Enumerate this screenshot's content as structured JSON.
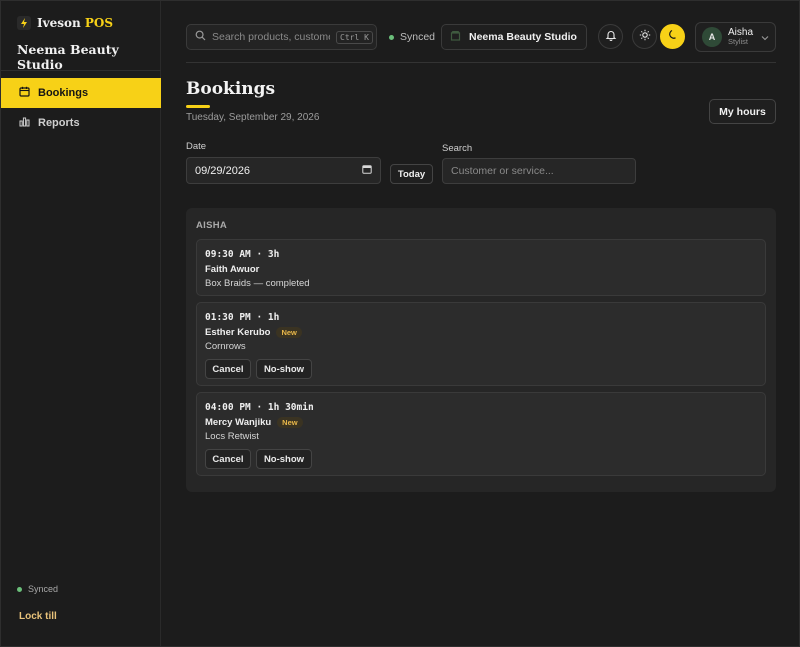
{
  "brand": {
    "name_main": "Iveson",
    "name_accent": "POS",
    "studio": "Neema Beauty Studio"
  },
  "sidebar": {
    "items": [
      {
        "label": "Bookings",
        "icon": "calendar-icon",
        "active": true
      },
      {
        "label": "Reports",
        "icon": "bar-chart-icon",
        "active": false
      }
    ],
    "status": "Synced",
    "lock_label": "Lock till"
  },
  "topbar": {
    "search_placeholder": "Search products, customers",
    "search_shortcut": "Ctrl K",
    "sync_status": "Synced",
    "store_name": "Neema Beauty Studio",
    "user": {
      "initial": "A",
      "name": "Aisha",
      "role": "Stylist"
    }
  },
  "page": {
    "title": "Bookings",
    "date": "Tuesday, September 29, 2026",
    "my_hours_label": "My hours",
    "date_label": "Date",
    "date_value": "09/29/2026",
    "today_label": "Today",
    "search_label": "Search",
    "search_placeholder": "Customer or service..."
  },
  "staff": {
    "name": "AISHA",
    "bookings": [
      {
        "time": "09:30 AM · 3h",
        "customer": "Faith Awuor",
        "service": "Box Braids — completed",
        "badge": ""
      },
      {
        "time": "01:30 PM · 1h",
        "customer": "Esther Kerubo",
        "service": "Cornrows",
        "badge": "New",
        "cancel_label": "Cancel",
        "noshow_label": "No-show"
      },
      {
        "time": "04:00 PM · 1h 30min",
        "customer": "Mercy Wanjiku",
        "service": "Locs Retwist",
        "badge": "New",
        "cancel_label": "Cancel",
        "noshow_label": "No-show"
      }
    ]
  },
  "colors": {
    "accent": "#f7d117",
    "background": "#1c1c1c",
    "panel": "#262626",
    "sync_dot": "#6bbf7a",
    "lock": "#e8c27a"
  }
}
